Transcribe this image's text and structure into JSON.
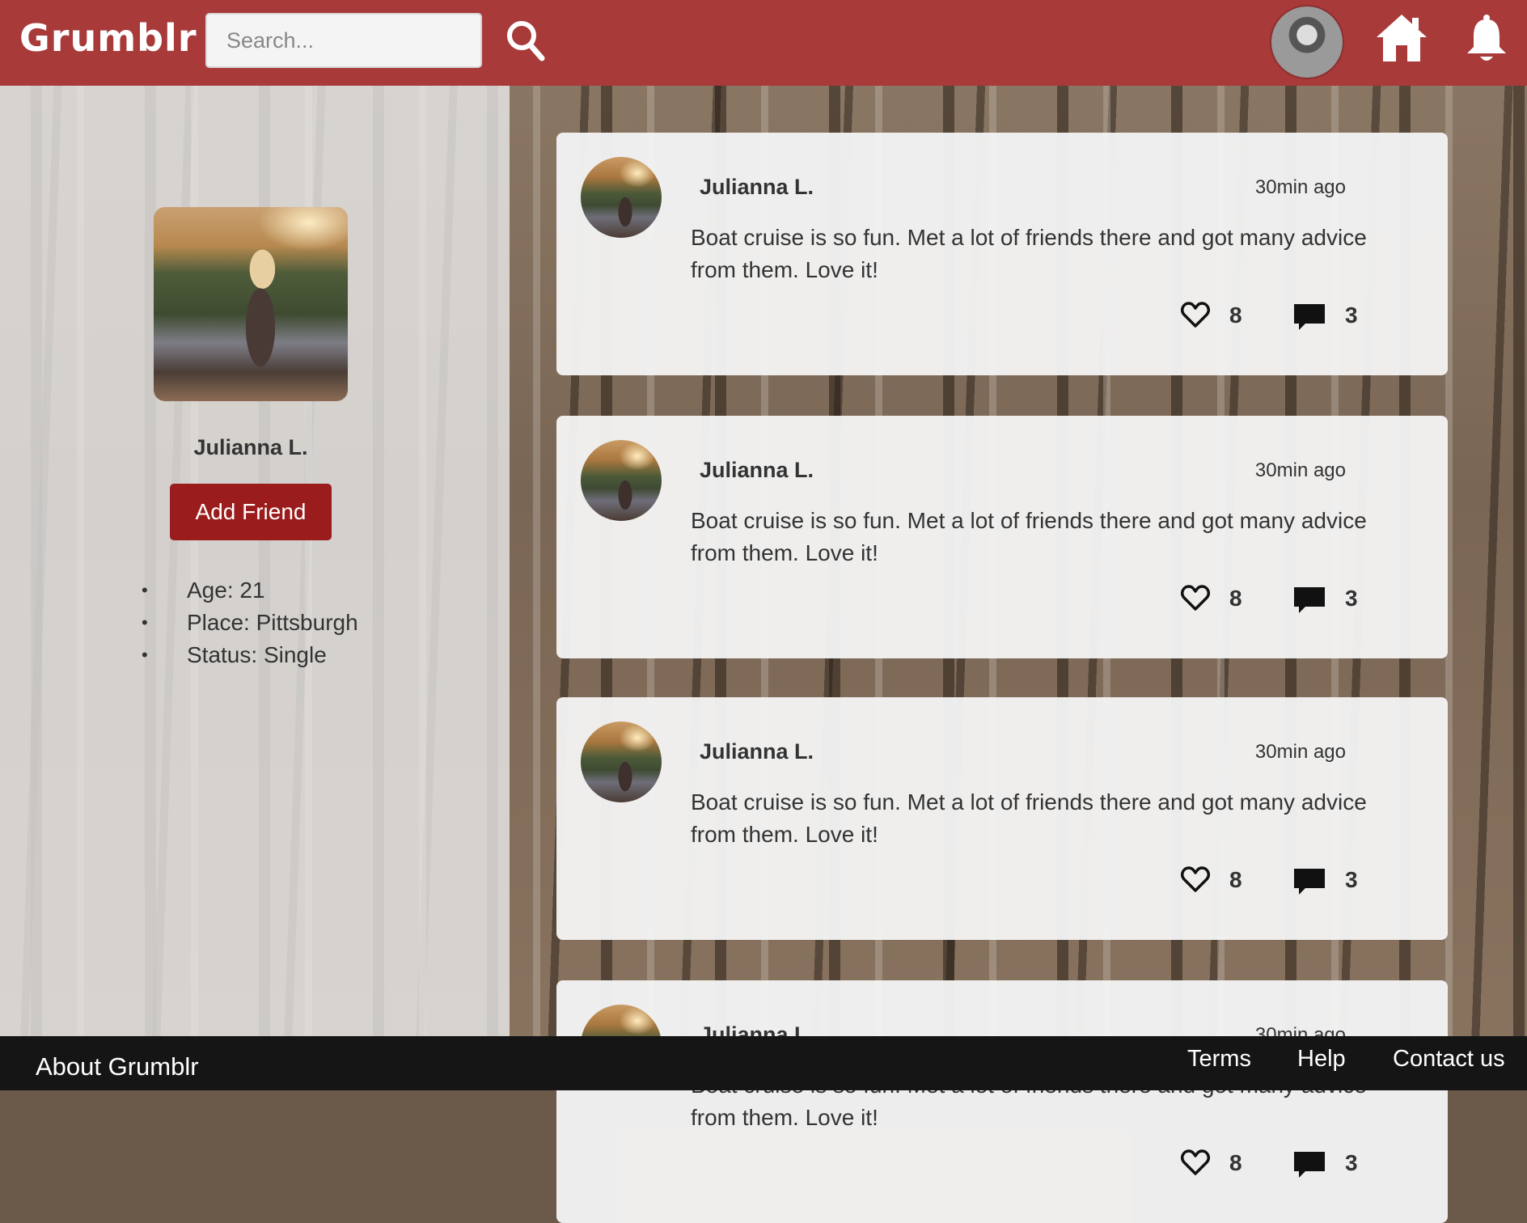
{
  "header": {
    "logo": "Grumblr",
    "search_placeholder": "Search...",
    "icons": [
      "search-icon",
      "avatar",
      "home-icon",
      "bell-icon"
    ]
  },
  "profile": {
    "name": "Julianna L.",
    "add_friend_label": "Add Friend",
    "info": [
      "Age: 21",
      "Place: Pittsburgh",
      "Status: Single"
    ]
  },
  "posts": [
    {
      "author": "Julianna L.",
      "time": "30min ago",
      "text": "Boat cruise is so fun. Met a lot of friends there and got many advice from them. Love it!",
      "likes": "8",
      "comments": "3"
    },
    {
      "author": "Julianna L.",
      "time": "30min ago",
      "text": "Boat cruise is so fun. Met a lot of friends there and got many advice from them. Love it!",
      "likes": "8",
      "comments": "3"
    },
    {
      "author": "Julianna L.",
      "time": "30min ago",
      "text": "Boat cruise is so fun. Met a lot of friends there and got many advice from them. Love it!",
      "likes": "8",
      "comments": "3"
    },
    {
      "author": "Julianna L.",
      "time": "30min ago",
      "text": "Boat cruise is so fun. Met a lot of friends there and got many advice from them. Love it!",
      "likes": "8",
      "comments": "3"
    }
  ],
  "footer": {
    "about": "About Grumblr",
    "links": [
      "Terms",
      "Help",
      "Contact us"
    ]
  },
  "colors": {
    "header_bg": "#a83a3a",
    "button_bg": "#9b1c1c",
    "footer_bg": "#151515"
  }
}
